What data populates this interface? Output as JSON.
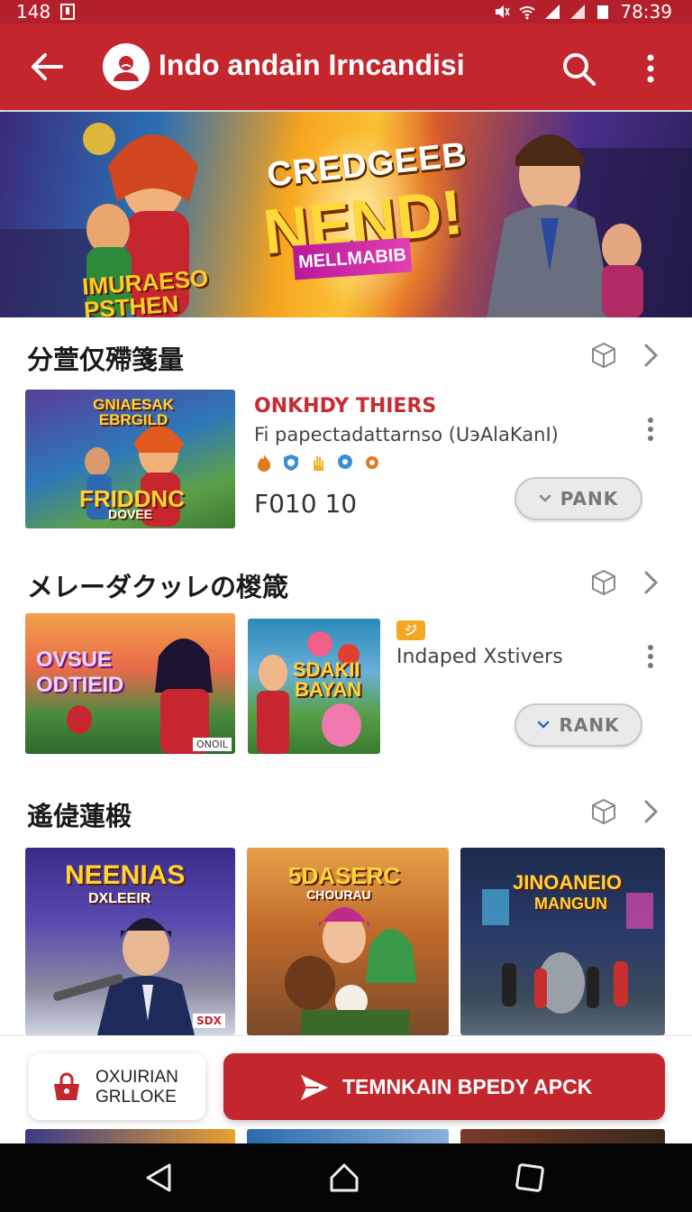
{
  "status_bar": {
    "left_text": "148",
    "time": "78:39"
  },
  "app_bar": {
    "title": "Indo andain Irncandisi"
  },
  "banner": {
    "headline_top": "CREDGEEB",
    "headline_main": "NEND!",
    "ribbon": "MELLMABIB",
    "left_logo_line1": "IMURAESO",
    "left_logo_line2": "PSTHEN"
  },
  "section1": {
    "title": "分萱仅殢箋量",
    "item": {
      "thumb_top": "GNIAESAK EBRGILD",
      "thumb_bottom": "FRIDDNC",
      "thumb_bottom2": "DOVEE",
      "title": "ONKHDY THIERS",
      "subtitle": "Fi papectadattarnso (UэAlaKanI)",
      "icons": [
        "flame-icon",
        "shield-icon",
        "hand-icon",
        "pin-icon",
        "gear-icon"
      ],
      "price": "F010 10",
      "button": "PANK"
    }
  },
  "section2": {
    "title": "メレーダクッレの椶箴",
    "thumb1_line1": "OVSUE",
    "thumb1_line2": "ODTIEID",
    "thumb1_tag": "ONOIL",
    "thumb2_line1": "SDAKII",
    "thumb2_line2": "BAYAN",
    "badge": "ジ",
    "item_title": "Indaped Xstivers",
    "button": "RANK"
  },
  "section3": {
    "title": "遙偼蓮椴",
    "cards": [
      {
        "line1": "NEENIAS",
        "line2": "DXLEEIR",
        "tag": "SDX"
      },
      {
        "line1": "5DASERC",
        "line2": "CHOURAU"
      },
      {
        "line1": "JINOANEIO",
        "line2": "MANGUN"
      }
    ]
  },
  "bottom_bar": {
    "secondary_line1": "OXUIRIAN",
    "secondary_line2": "GRLLOKE",
    "primary_label": "TEMNKAIN BPEDY APCK"
  },
  "colors": {
    "brand_red": "#c4262e",
    "status_red": "#b3202b",
    "pill_grey": "#eaeaea"
  }
}
